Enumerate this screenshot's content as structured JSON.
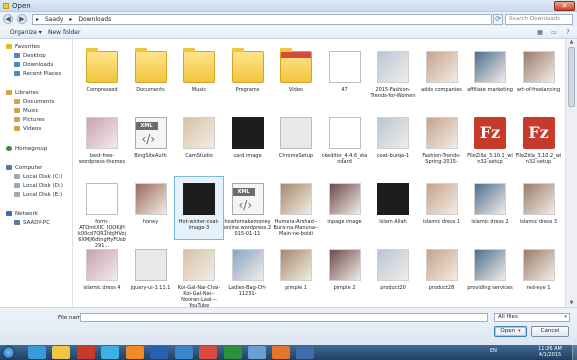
{
  "window": {
    "title": "Open",
    "close_label": "✕"
  },
  "navigation": {
    "back_label": "◀",
    "forward_label": "▶",
    "crumbs": [
      "Saady",
      "Downloads"
    ],
    "separator": "▸",
    "refresh_label": "⟳",
    "search_placeholder": "Search Downloads"
  },
  "toolbar": {
    "organize_label": "Organize ▾",
    "new_folder_label": "New folder"
  },
  "sidebar": {
    "favorites": "Favorites",
    "fav_items": [
      "Desktop",
      "Downloads",
      "Recent Places"
    ],
    "libraries": "Libraries",
    "lib_items": [
      "Documents",
      "Music",
      "Pictures",
      "Videos"
    ],
    "homegroup": "Homegroup",
    "computer": "Computer",
    "drives": [
      "Local Disk (C:)",
      "Local Disk (D:)",
      "Local Disk (E:)"
    ],
    "network": "Network",
    "network_items": [
      "SAADY-PC"
    ]
  },
  "files": [
    "Compressed",
    "Documents",
    "Music",
    "Programs",
    "Video",
    "47",
    "2015-Fashion-Trends-for-Women",
    "adds companies",
    "affiliate marketing",
    "art-of-freelancing",
    "best-free-wordpress-themes",
    "BingSiteAuth",
    "CamStudio",
    "card image",
    "ChromeSetup",
    "ckeditor_4.4.6_standard",
    "coat-burqa-1",
    "Fashion-Trends-Spring-2015-",
    "FileZilla_3.10.1_win32-setup",
    "FileZilla_3.10.2_win32-setup",
    "form-ATOmtXIC_IOOKjHk00cd7QR1hbJHVoj6XMjl6dtngHyFUsb291...",
    "honey",
    "Hot-winter-coat-image-3",
    "howtomakemoneyonline.wordpress.2015-01-11",
    "Humera-Arshad--Bura-na-Manuna--Main-ne-boldi",
    "inpage image",
    "Islam Allah",
    "islamic dress 1",
    "islamic dress 2",
    "islamic dress 3",
    "islamic dress 4",
    "jquery-ui-1.11.1",
    "Koi-Gal-Nai-Chai-Koi-Gal-Nai--Nooran-Laal---YouTube",
    "Ladies-Bag-CH-11231-",
    "pimple 1",
    "pimple 2",
    "product20",
    "product28",
    "providing services",
    "red-eye 1"
  ],
  "bottom": {
    "file_name_label": "File name:",
    "file_name_value": "",
    "file_type_value": "All files",
    "open_label": "Open",
    "cancel_label": "Cancel"
  },
  "taskbar": {
    "lang": "EN",
    "time": "11:26 AM",
    "date": "4/1/2015"
  }
}
